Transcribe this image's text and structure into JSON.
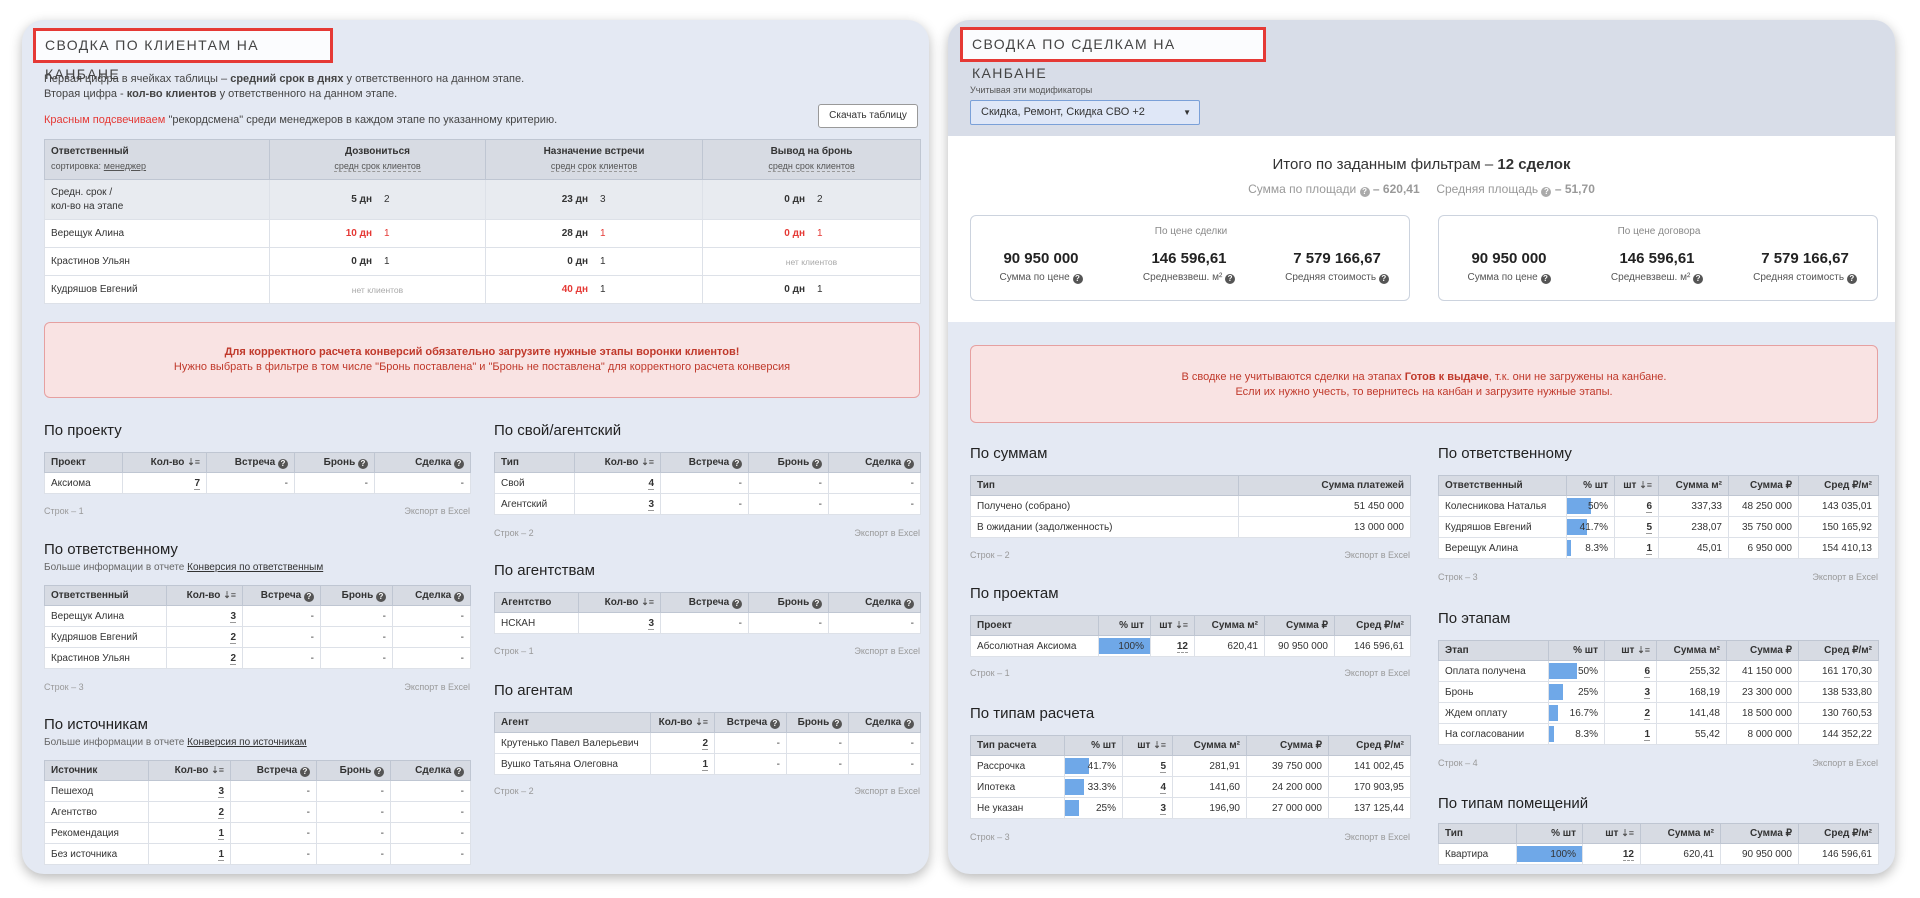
{
  "left": {
    "title": "СВОДКА ПО КЛИЕНТАМ НА КАНБАНЕ",
    "intro1_pre": "Первая цифра в ячейках таблицы –",
    "intro1_bold": "средний срок в днях",
    "intro1_post": "у ответственного на данном этапе.",
    "intro2_pre": "Вторая цифра -",
    "intro2_bold": "кол-во клиентов",
    "intro2_post": "у ответственного на данном этапе.",
    "intro3_red": "Красным подсвечиваем",
    "intro3_post": "\"рекордсмена\" среди менеджеров в каждом этапе по указанному критерию.",
    "download_btn": "Скачать таблицу",
    "main_table": {
      "h_resp": "Ответственный",
      "h_sort": "сортировка:",
      "h_sort_link": "менеджер",
      "stages": [
        "Дозвониться",
        "Назначение встречи",
        "Вывод на бронь"
      ],
      "sub_avg": "средн срок",
      "sub_cnt": "клиентов",
      "avg_label1": "Средн. срок /",
      "avg_label2": "кол-во на этапе",
      "avg_row": [
        [
          "5 дн",
          "2"
        ],
        [
          "23 дн",
          "3"
        ],
        [
          "0 дн",
          "2"
        ]
      ],
      "rows": [
        {
          "name": "Верещук Алина",
          "cells": [
            [
              "10 дн",
              "1"
            ],
            [
              "28 дн",
              "1"
            ],
            [
              "0 дн",
              "1"
            ]
          ]
        },
        {
          "name": "Крастинов Ульян",
          "cells": [
            [
              "0 дн",
              "1"
            ],
            [
              "0 дн",
              "1"
            ],
            [
              "нет клиентов",
              ""
            ]
          ]
        },
        {
          "name": "Кудряшов Евгений",
          "cells": [
            [
              "нет клиентов",
              ""
            ],
            [
              "40 дн",
              "1"
            ],
            [
              "0 дн",
              "1"
            ]
          ]
        }
      ]
    },
    "alert_line1": "Для корректного расчета конверсий обязательно загрузите нужные этапы воронки клиентов!",
    "alert_line2": "Нужно выбрать в фильтре в том числе \"Бронь поставлена\" и \"Бронь не поставлена\" для корректного расчета конверсия",
    "headers": {
      "qty": "Кол-во",
      "meeting": "Встреча",
      "booking": "Бронь",
      "deal": "Сделка"
    },
    "dash": "-",
    "export": "Экспорт в Excel",
    "by_project": {
      "title": "По проекту",
      "col": "Проект",
      "rows": [
        {
          "name": "Аксиома",
          "qty": "7"
        }
      ],
      "count": "Строк – 1"
    },
    "by_type": {
      "title": "По свой/агентский",
      "col": "Тип",
      "rows": [
        {
          "name": "Свой",
          "qty": "4"
        },
        {
          "name": "Агентский",
          "qty": "3"
        }
      ],
      "count": "Строк – 2"
    },
    "by_resp": {
      "title": "По ответственному",
      "sub_pre": "Больше информации в отчете",
      "sub_link": "Конверсия по ответственным",
      "col": "Ответственный",
      "rows": [
        {
          "name": "Верещук Алина",
          "qty": "3"
        },
        {
          "name": "Кудряшов Евгений",
          "qty": "2"
        },
        {
          "name": "Крастинов Ульян",
          "qty": "2"
        }
      ],
      "count": "Строк – 3"
    },
    "by_agency": {
      "title": "По агентствам",
      "col": "Агентство",
      "rows": [
        {
          "name": "НСКАН",
          "qty": "3"
        }
      ],
      "count": "Строк – 1"
    },
    "by_source": {
      "title": "По источникам",
      "sub_pre": "Больше информации в отчете",
      "sub_link": "Конверсия по источникам",
      "col": "Источник",
      "rows": [
        {
          "name": "Пешеход",
          "qty": "3"
        },
        {
          "name": "Агентство",
          "qty": "2"
        },
        {
          "name": "Рекомендация",
          "qty": "1"
        },
        {
          "name": "Без источника",
          "qty": "1"
        }
      ]
    },
    "by_agent": {
      "title": "По агентам",
      "col": "Агент",
      "rows": [
        {
          "name": "Крутенько Павел Валерьевич",
          "qty": "2"
        },
        {
          "name": "Вушко Татьяна Олеговна",
          "qty": "1"
        }
      ],
      "count": "Строк – 2"
    }
  },
  "right": {
    "title": "СВОДКА ПО СДЕЛКАМ НА КАНБАНЕ",
    "mod_label": "Учитывая эти модификаторы",
    "mod_value": "Скидка, Ремонт, Скидка СВО +2",
    "total_pre": "Итого по заданным фильтрам –",
    "total_bold": "12 сделок",
    "area_sum_label": "Сумма по площади",
    "area_sum_value": "– 620,41",
    "area_avg_label": "Средняя площадь",
    "area_avg_value": "– 51,70",
    "card1": {
      "title": "По цене сделки",
      "values": [
        {
          "v": "90 950 000",
          "l": "Сумма по цене"
        },
        {
          "v": "146 596,61",
          "l": "Средневзвеш. м²"
        },
        {
          "v": "7 579 166,67",
          "l": "Средняя стоимость"
        }
      ]
    },
    "card2": {
      "title": "По цене договора",
      "values": [
        {
          "v": "90 950 000",
          "l": "Сумма по цене"
        },
        {
          "v": "146 596,61",
          "l": "Средневзвеш. м²"
        },
        {
          "v": "7 579 166,67",
          "l": "Средняя стоимость"
        }
      ]
    },
    "alert_pre": "В сводке не учитываются сделки на этапах",
    "alert_bold": "Готов к выдаче",
    "alert_post": ", т.к. они не загружены на канбане.",
    "alert_line2": "Если их нужно учесть, то вернитесь на канбан и загрузите нужные этапы.",
    "export": "Экспорт в Excel",
    "h": {
      "pct": "% шт",
      "qty": "шт",
      "m2": "Сумма м²",
      "rub": "Сумма ₽",
      "avg": "Сред ₽/м²"
    },
    "by_sum": {
      "title": "По суммам",
      "col1": "Тип",
      "col2": "Сумма платежей",
      "rows": [
        {
          "name": "Получено (собрано)",
          "v": "51 450 000"
        },
        {
          "name": "В ожидании (задолженность)",
          "v": "13 000 000"
        }
      ],
      "count": "Строк – 2"
    },
    "by_projects": {
      "title": "По проектам",
      "col": "Проект",
      "rows": [
        {
          "name": "Абсолютная Аксиома",
          "pct": "100%",
          "p": 1,
          "qty": "12",
          "m2": "620,41",
          "rub": "90 950 000",
          "avg": "146 596,61"
        }
      ],
      "count": "Строк – 1"
    },
    "by_calc": {
      "title": "По типам расчета",
      "col": "Тип расчета",
      "rows": [
        {
          "name": "Рассрочка",
          "pct": "41.7%",
          "p": 0.417,
          "qty": "5",
          "m2": "281,91",
          "rub": "39 750 000",
          "avg": "141 002,45"
        },
        {
          "name": "Ипотека",
          "pct": "33.3%",
          "p": 0.333,
          "qty": "4",
          "m2": "141,60",
          "rub": "24 200 000",
          "avg": "170 903,95"
        },
        {
          "name": "Не указан",
          "pct": "25%",
          "p": 0.25,
          "qty": "3",
          "m2": "196,90",
          "rub": "27 000 000",
          "avg": "137 125,44"
        }
      ],
      "count": "Строк – 3"
    },
    "by_resp": {
      "title": "По ответственному",
      "col": "Ответственный",
      "rows": [
        {
          "name": "Колесникова Наталья",
          "pct": "50%",
          "p": 0.5,
          "qty": "6",
          "m2": "337,33",
          "rub": "48 250 000",
          "avg": "143 035,01"
        },
        {
          "name": "Кудряшов Евгений",
          "pct": "41.7%",
          "p": 0.417,
          "qty": "5",
          "m2": "238,07",
          "rub": "35 750 000",
          "avg": "150 165,92"
        },
        {
          "name": "Верещук Алина",
          "pct": "8.3%",
          "p": 0.083,
          "qty": "1",
          "m2": "45,01",
          "rub": "6 950 000",
          "avg": "154 410,13"
        }
      ],
      "count": "Строк – 3"
    },
    "by_stage": {
      "title": "По этапам",
      "col": "Этап",
      "rows": [
        {
          "name": "Оплата получена",
          "pct": "50%",
          "p": 0.5,
          "qty": "6",
          "m2": "255,32",
          "rub": "41 150 000",
          "avg": "161 170,30"
        },
        {
          "name": "Бронь",
          "pct": "25%",
          "p": 0.25,
          "qty": "3",
          "m2": "168,19",
          "rub": "23 300 000",
          "avg": "138 533,80"
        },
        {
          "name": "Ждем оплату",
          "pct": "16.7%",
          "p": 0.167,
          "qty": "2",
          "m2": "141,48",
          "rub": "18 500 000",
          "avg": "130 760,53"
        },
        {
          "name": "На согласовании",
          "pct": "8.3%",
          "p": 0.083,
          "qty": "1",
          "m2": "55,42",
          "rub": "8 000 000",
          "avg": "144 352,22"
        }
      ],
      "count": "Строк – 4"
    },
    "by_room": {
      "title": "По типам помещений",
      "col": "Тип",
      "rows": [
        {
          "name": "Квартира",
          "pct": "100%",
          "p": 1,
          "qty": "12",
          "m2": "620,41",
          "rub": "90 950 000",
          "avg": "146 596,61"
        }
      ]
    }
  }
}
